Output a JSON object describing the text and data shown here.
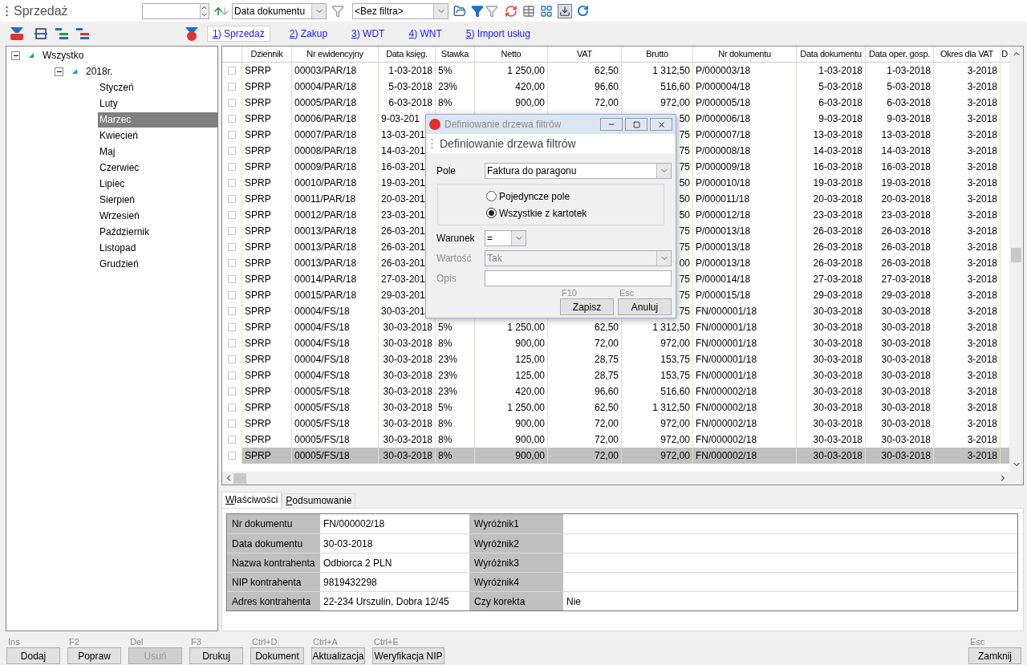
{
  "header": {
    "title": "Sprzedaż"
  },
  "toolbar": {
    "sort_field": "Data dokumentu",
    "filter_field": "<Bez filtra>"
  },
  "register_tabs": [
    {
      "label": "1) Sprzedaż",
      "selected": true
    },
    {
      "label": "2) Zakup",
      "selected": false
    },
    {
      "label": "3) WDT",
      "selected": false
    },
    {
      "label": "4) WNT",
      "selected": false
    },
    {
      "label": "5) Import usług",
      "selected": false
    }
  ],
  "tree": [
    {
      "label": "Wszystko",
      "expanded": true,
      "selected": false,
      "children": [
        {
          "label": "2018r.",
          "expanded": true,
          "selected": false,
          "children": [
            {
              "label": "Styczeń",
              "selected": false
            },
            {
              "label": "Luty",
              "selected": false
            },
            {
              "label": "Marzec",
              "selected": true
            },
            {
              "label": "Kwiecień",
              "selected": false
            },
            {
              "label": "Maj",
              "selected": false
            },
            {
              "label": "Czerwiec",
              "selected": false
            },
            {
              "label": "Lipiec",
              "selected": false
            },
            {
              "label": "Sierpień",
              "selected": false
            },
            {
              "label": "Wrzesień",
              "selected": false
            },
            {
              "label": "Październik",
              "selected": false
            },
            {
              "label": "Listopad",
              "selected": false
            },
            {
              "label": "Grudzień",
              "selected": false
            }
          ]
        }
      ]
    }
  ],
  "grid": {
    "columns": [
      {
        "label": "Dziennik"
      },
      {
        "label": "Nr ewidencyjny"
      },
      {
        "label": "Data księg."
      },
      {
        "label": "Stawka"
      },
      {
        "label": "Netto"
      },
      {
        "label": "VAT"
      },
      {
        "label": "Brutto"
      },
      {
        "label": "Nr dokumentu"
      },
      {
        "label": "Data dokumentu"
      },
      {
        "label": "Data oper. gosp."
      },
      {
        "label": "Okres dla VAT"
      },
      {
        "label": "D"
      }
    ],
    "rows": [
      {
        "checked": false,
        "selected": false,
        "covered": false,
        "cells": [
          "SPRP",
          "00003/PAR/18",
          "1-03-2018",
          "5%",
          "1 250,00",
          "62,50",
          "1 312,50",
          "P/000003/18",
          "1-03-2018",
          "1-03-2018",
          "3-2018"
        ]
      },
      {
        "checked": false,
        "selected": false,
        "covered": false,
        "cells": [
          "SPRP",
          "00004/PAR/18",
          "5-03-2018",
          "23%",
          "420,00",
          "96,60",
          "516,60",
          "P/000004/18",
          "5-03-2018",
          "5-03-2018",
          "3-2018"
        ]
      },
      {
        "checked": false,
        "selected": false,
        "covered": false,
        "cells": [
          "SPRP",
          "00005/PAR/18",
          "6-03-2018",
          "8%",
          "900,00",
          "72,00",
          "972,00",
          "P/000005/18",
          "6-03-2018",
          "6-03-2018",
          "3-2018"
        ]
      },
      {
        "checked": false,
        "selected": false,
        "covered": true,
        "cells": [
          "SPRP",
          "00006/PAR/18",
          "9-03-201",
          null,
          null,
          null,
          "50",
          "P/000006/18",
          "9-03-2018",
          "9-03-2018",
          "3-2018"
        ]
      },
      {
        "checked": false,
        "selected": false,
        "covered": true,
        "cells": [
          "SPRP",
          "00007/PAR/18",
          "13-03-201",
          null,
          null,
          null,
          "75",
          "P/000007/18",
          "13-03-2018",
          "13-03-2018",
          "3-2018"
        ]
      },
      {
        "checked": false,
        "selected": false,
        "covered": true,
        "cells": [
          "SPRP",
          "00008/PAR/18",
          "14-03-201",
          null,
          null,
          null,
          "75",
          "P/000008/18",
          "14-03-2018",
          "14-03-2018",
          "3-2018"
        ]
      },
      {
        "checked": false,
        "selected": false,
        "covered": true,
        "cells": [
          "SPRP",
          "00009/PAR/18",
          "16-03-201",
          null,
          null,
          null,
          "75",
          "P/000009/18",
          "16-03-2018",
          "16-03-2018",
          "3-2018"
        ]
      },
      {
        "checked": false,
        "selected": false,
        "covered": true,
        "cells": [
          "SPRP",
          "00010/PAR/18",
          "19-03-201",
          null,
          null,
          null,
          "50",
          "P/000010/18",
          "19-03-2018",
          "19-03-2018",
          "3-2018"
        ]
      },
      {
        "checked": false,
        "selected": false,
        "covered": true,
        "cells": [
          "SPRP",
          "00011/PAR/18",
          "20-03-201",
          null,
          null,
          null,
          "50",
          "P/000011/18",
          "20-03-2018",
          "20-03-2018",
          "3-2018"
        ]
      },
      {
        "checked": false,
        "selected": false,
        "covered": true,
        "cells": [
          "SPRP",
          "00012/PAR/18",
          "23-03-201",
          null,
          null,
          null,
          "50",
          "P/000012/18",
          "23-03-2018",
          "23-03-2018",
          "3-2018"
        ]
      },
      {
        "checked": false,
        "selected": false,
        "covered": true,
        "cells": [
          "SPRP",
          "00013/PAR/18",
          "26-03-201",
          null,
          null,
          null,
          "75",
          "P/000013/18",
          "26-03-2018",
          "26-03-2018",
          "3-2018"
        ]
      },
      {
        "checked": false,
        "selected": false,
        "covered": true,
        "cells": [
          "SPRP",
          "00013/PAR/18",
          "26-03-201",
          null,
          null,
          null,
          "75",
          "P/000013/18",
          "26-03-2018",
          "26-03-2018",
          "3-2018"
        ]
      },
      {
        "checked": false,
        "selected": false,
        "covered": true,
        "cells": [
          "SPRP",
          "00013/PAR/18",
          "26-03-201",
          null,
          null,
          null,
          "00",
          "P/000013/18",
          "26-03-2018",
          "26-03-2018",
          "3-2018"
        ]
      },
      {
        "checked": false,
        "selected": false,
        "covered": true,
        "cells": [
          "SPRP",
          "00014/PAR/18",
          "27-03-201",
          null,
          null,
          null,
          "75",
          "P/000014/18",
          "27-03-2018",
          "27-03-2018",
          "3-2018"
        ]
      },
      {
        "checked": false,
        "selected": false,
        "covered": true,
        "cells": [
          "SPRP",
          "00015/PAR/18",
          "29-03-201",
          null,
          null,
          null,
          "75",
          "P/000015/18",
          "29-03-2018",
          "29-03-2018",
          "3-2018"
        ]
      },
      {
        "checked": false,
        "selected": false,
        "covered": true,
        "cells": [
          "SPRP",
          "00004/FS/18",
          "30-03-201",
          null,
          null,
          null,
          "75",
          "FN/000001/18",
          "30-03-2018",
          "30-03-2018",
          "3-2018"
        ]
      },
      {
        "checked": false,
        "selected": false,
        "covered": false,
        "cells": [
          "SPRP",
          "00004/FS/18",
          "30-03-2018",
          "5%",
          "1 250,00",
          "62,50",
          "1 312,50",
          "FN/000001/18",
          "30-03-2018",
          "30-03-2018",
          "3-2018"
        ]
      },
      {
        "checked": false,
        "selected": false,
        "covered": false,
        "cells": [
          "SPRP",
          "00004/FS/18",
          "30-03-2018",
          "8%",
          "900,00",
          "72,00",
          "972,00",
          "FN/000001/18",
          "30-03-2018",
          "30-03-2018",
          "3-2018"
        ]
      },
      {
        "checked": false,
        "selected": false,
        "covered": false,
        "cells": [
          "SPRP",
          "00004/FS/18",
          "30-03-2018",
          "23%",
          "125,00",
          "28,75",
          "153,75",
          "FN/000001/18",
          "30-03-2018",
          "30-03-2018",
          "3-2018"
        ]
      },
      {
        "checked": false,
        "selected": false,
        "covered": false,
        "cells": [
          "SPRP",
          "00004/FS/18",
          "30-03-2018",
          "23%",
          "125,00",
          "28,75",
          "153,75",
          "FN/000001/18",
          "30-03-2018",
          "30-03-2018",
          "3-2018"
        ]
      },
      {
        "checked": false,
        "selected": false,
        "covered": false,
        "cells": [
          "SPRP",
          "00005/FS/18",
          "30-03-2018",
          "23%",
          "420,00",
          "96,60",
          "516,60",
          "FN/000002/18",
          "30-03-2018",
          "30-03-2018",
          "3-2018"
        ]
      },
      {
        "checked": false,
        "selected": false,
        "covered": false,
        "cells": [
          "SPRP",
          "00005/FS/18",
          "30-03-2018",
          "5%",
          "1 250,00",
          "62,50",
          "1 312,50",
          "FN/000002/18",
          "30-03-2018",
          "30-03-2018",
          "3-2018"
        ]
      },
      {
        "checked": false,
        "selected": false,
        "covered": false,
        "cells": [
          "SPRP",
          "00005/FS/18",
          "30-03-2018",
          "8%",
          "900,00",
          "72,00",
          "972,00",
          "FN/000002/18",
          "30-03-2018",
          "30-03-2018",
          "3-2018"
        ]
      },
      {
        "checked": false,
        "selected": false,
        "covered": false,
        "cells": [
          "SPRP",
          "00005/FS/18",
          "30-03-2018",
          "8%",
          "900,00",
          "72,00",
          "972,00",
          "FN/000002/18",
          "30-03-2018",
          "30-03-2018",
          "3-2018"
        ]
      },
      {
        "checked": false,
        "selected": true,
        "covered": false,
        "cells": [
          "SPRP",
          "00005/FS/18",
          "30-03-2018",
          "8%",
          "900,00",
          "72,00",
          "972,00",
          "FN/000002/18",
          "30-03-2018",
          "30-03-2018",
          "3-2018"
        ]
      }
    ]
  },
  "detail_tabs": [
    {
      "label": "Właściwości",
      "selected": true
    },
    {
      "label": "Podsumowanie",
      "selected": false
    }
  ],
  "properties": [
    [
      {
        "label": "Nr dokumentu",
        "value": "FN/000002/18"
      },
      {
        "label": "Wyróżnik1"
      }
    ],
    [
      {
        "label": "Data dokumentu",
        "value": "30-03-2018"
      },
      {
        "label": "Wyróżnik2"
      }
    ],
    [
      {
        "label": "Nazwa kontrahenta",
        "value": "Odbiorca 2 PLN"
      },
      {
        "label": "Wyróżnik3"
      }
    ],
    [
      {
        "label": "NIP kontrahenta",
        "value": "9819432298"
      },
      {
        "label": "Wyróżnik4"
      }
    ],
    [
      {
        "label": "Adres kontrahenta",
        "value": "22-234 Urszulin, Dobra 12/45"
      },
      {
        "label": "Czy korekta",
        "value": "Nie"
      }
    ]
  ],
  "buttons": [
    {
      "shortcut": "Ins",
      "label": "Dodaj",
      "disabled": false
    },
    {
      "shortcut": "F2",
      "label": "Popraw",
      "disabled": false
    },
    {
      "shortcut": "Del",
      "label": "Usuń",
      "disabled": true
    },
    {
      "shortcut": "F3",
      "label": "Drukuj",
      "disabled": false
    },
    {
      "shortcut": "Ctrl+D",
      "label": "Dokument",
      "disabled": false
    },
    {
      "shortcut": "Ctrl+A",
      "label": "Aktualizacja",
      "disabled": false
    },
    {
      "shortcut": "Ctrl+E",
      "label": "Weryfikacja NIP",
      "disabled": false
    }
  ],
  "close_button": {
    "shortcut": "Esc",
    "label": "Zamknij"
  },
  "dialog": {
    "window_title": "Definiowanie drzewa filtrów",
    "heading": "Definiowanie drzewa filtrów",
    "field_label": "Pole",
    "field_value": "Faktura do paragonu",
    "options": [
      {
        "label": "Pojedyncze pole",
        "selected": false
      },
      {
        "label": "Wszystkie z kartotek",
        "selected": true
      }
    ],
    "condition_label": "Warunek",
    "condition_value": "=",
    "value_label": "Wartość",
    "value_value": "Tak",
    "value_disabled": true,
    "description_label": "Opis",
    "buttons": [
      {
        "shortcut": "F10",
        "label": "Zapisz"
      },
      {
        "shortcut": "Esc",
        "label": "Anuluj"
      }
    ]
  }
}
